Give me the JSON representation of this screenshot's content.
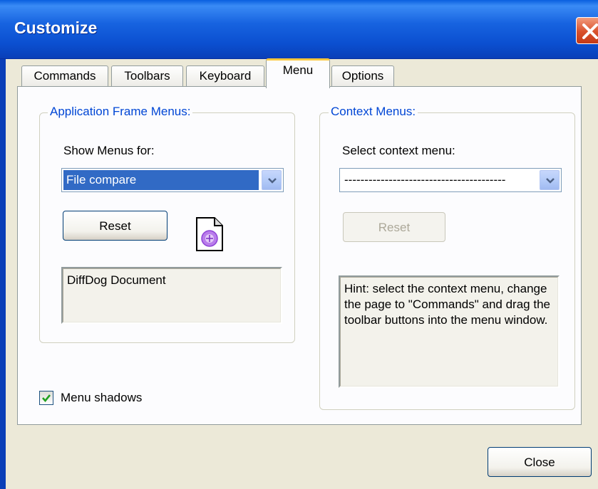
{
  "window": {
    "title": "Customize"
  },
  "tabs": [
    {
      "label": "Commands",
      "active": false
    },
    {
      "label": "Toolbars",
      "active": false
    },
    {
      "label": "Keyboard",
      "active": false
    },
    {
      "label": "Menu",
      "active": true
    },
    {
      "label": "Options",
      "active": false
    }
  ],
  "app_menus": {
    "legend": "Application Frame Menus:",
    "show_label": "Show Menus for:",
    "selected": "File compare",
    "reset_label": "Reset",
    "description": "DiffDog Document",
    "document_icon": "document-icon"
  },
  "context_menus": {
    "legend": "Context Menus:",
    "select_label": "Select context menu:",
    "selected": "----------------------------------------",
    "reset_label": "Reset",
    "reset_enabled": false,
    "hint": "Hint: select the context menu, change the page to \"Commands\" and drag the toolbar buttons into the menu window."
  },
  "menu_shadows": {
    "label": "Menu shadows",
    "checked": true
  },
  "footer": {
    "close_label": "Close"
  },
  "colors": {
    "titlebar": "#0A58DB",
    "legend": "#0046D5",
    "selection": "#316AC5",
    "active_tab_accent": "#FFC83C"
  }
}
